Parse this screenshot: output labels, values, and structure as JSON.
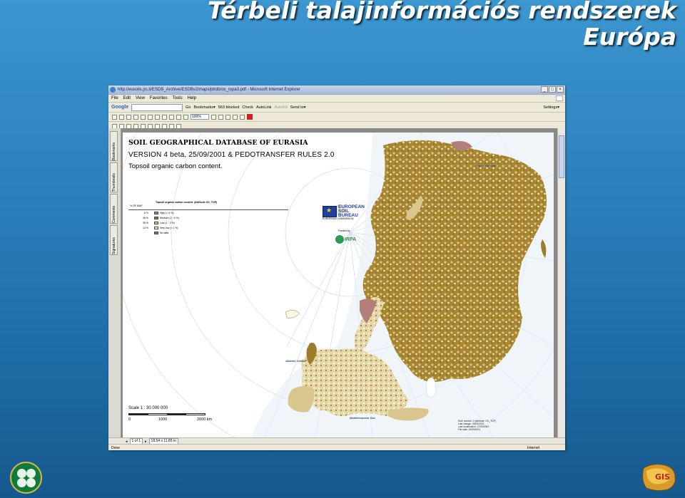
{
  "slide": {
    "title_line1": "Térbeli talajinformációs rendszerek",
    "title_line2": "Európa",
    "logo_right_text": "GIS"
  },
  "browser": {
    "window_title": "http://eusoils.jrc.it/ESDB_Archive/ESDBv2/maps/ptrdb/oc_topa3.pdf - Microsoft Internet Explorer",
    "menu": [
      "File",
      "Edit",
      "View",
      "Favorites",
      "Tools",
      "Help"
    ],
    "google_bar": {
      "logo": "Google",
      "go": "Go",
      "bookmarks": "Bookmarks▾",
      "blocked": "563 blocked",
      "check": "Check",
      "autolink": "AutoLink",
      "autofill": "AutoFill",
      "send_to": "Send to▾",
      "settings": "Settings▾"
    },
    "zoom_value": "100%",
    "nav_tabs": [
      "Bookmarks",
      "Thumbnails",
      "Comments",
      "Signatures"
    ],
    "pdf_status": {
      "page": "1 of 1",
      "size": "18.54 x 11.89 in"
    },
    "ie_status": {
      "left": "Done",
      "zone": "Internet"
    }
  },
  "map": {
    "title": "SOIL GEOGRAPHICAL DATABASE OF EURASIA",
    "version": "VERSION 4 beta, 25/09/2001 & PEDOTRANSFER RULES 2.0",
    "subtitle": "Topsoil organic carbon content.",
    "legend": {
      "heading": "Topsoil organic carbon content. (Attribute OC_TOP)",
      "pct_header": "% OF MAP",
      "rows": [
        {
          "pct": "6 %",
          "label": "High (> 6 %)",
          "color": "#b37f7b"
        },
        {
          "pct": "46 %",
          "label": "Medium (2 - 6 %)",
          "color": "#9c7b2b"
        },
        {
          "pct": "35 %",
          "label": "Low (1 - 2 %)",
          "color": "#d9c68f"
        },
        {
          "pct": "13 %",
          "label": "Very low (< 1 %)",
          "color": "#fbf7e4"
        },
        {
          "pct": "",
          "label": "No data",
          "color": "#7c7c7c"
        }
      ]
    },
    "logos": {
      "esb": "EUROPEAN SOIL BUREAU",
      "esb_sub": "EUROPEAN COMMISSION",
      "funded": "Funded by",
      "ispra": "IRPA"
    },
    "seas": {
      "okhotsk": "Sea of Okhotsk",
      "atlantic": "Atlantic Ocean",
      "mediterranean": "Mediterranean Sea"
    },
    "scale": {
      "label": "Scale 1 : 30 000 000",
      "ticks": [
        "0",
        "1000",
        "2000 km"
      ]
    },
    "credits": [
      "Rule number: 2 (attribute: OC_TOP)",
      "Last change: 25/09/2001",
      "Last modification: 17/09/2002",
      "File date: 19/09/2001"
    ]
  }
}
